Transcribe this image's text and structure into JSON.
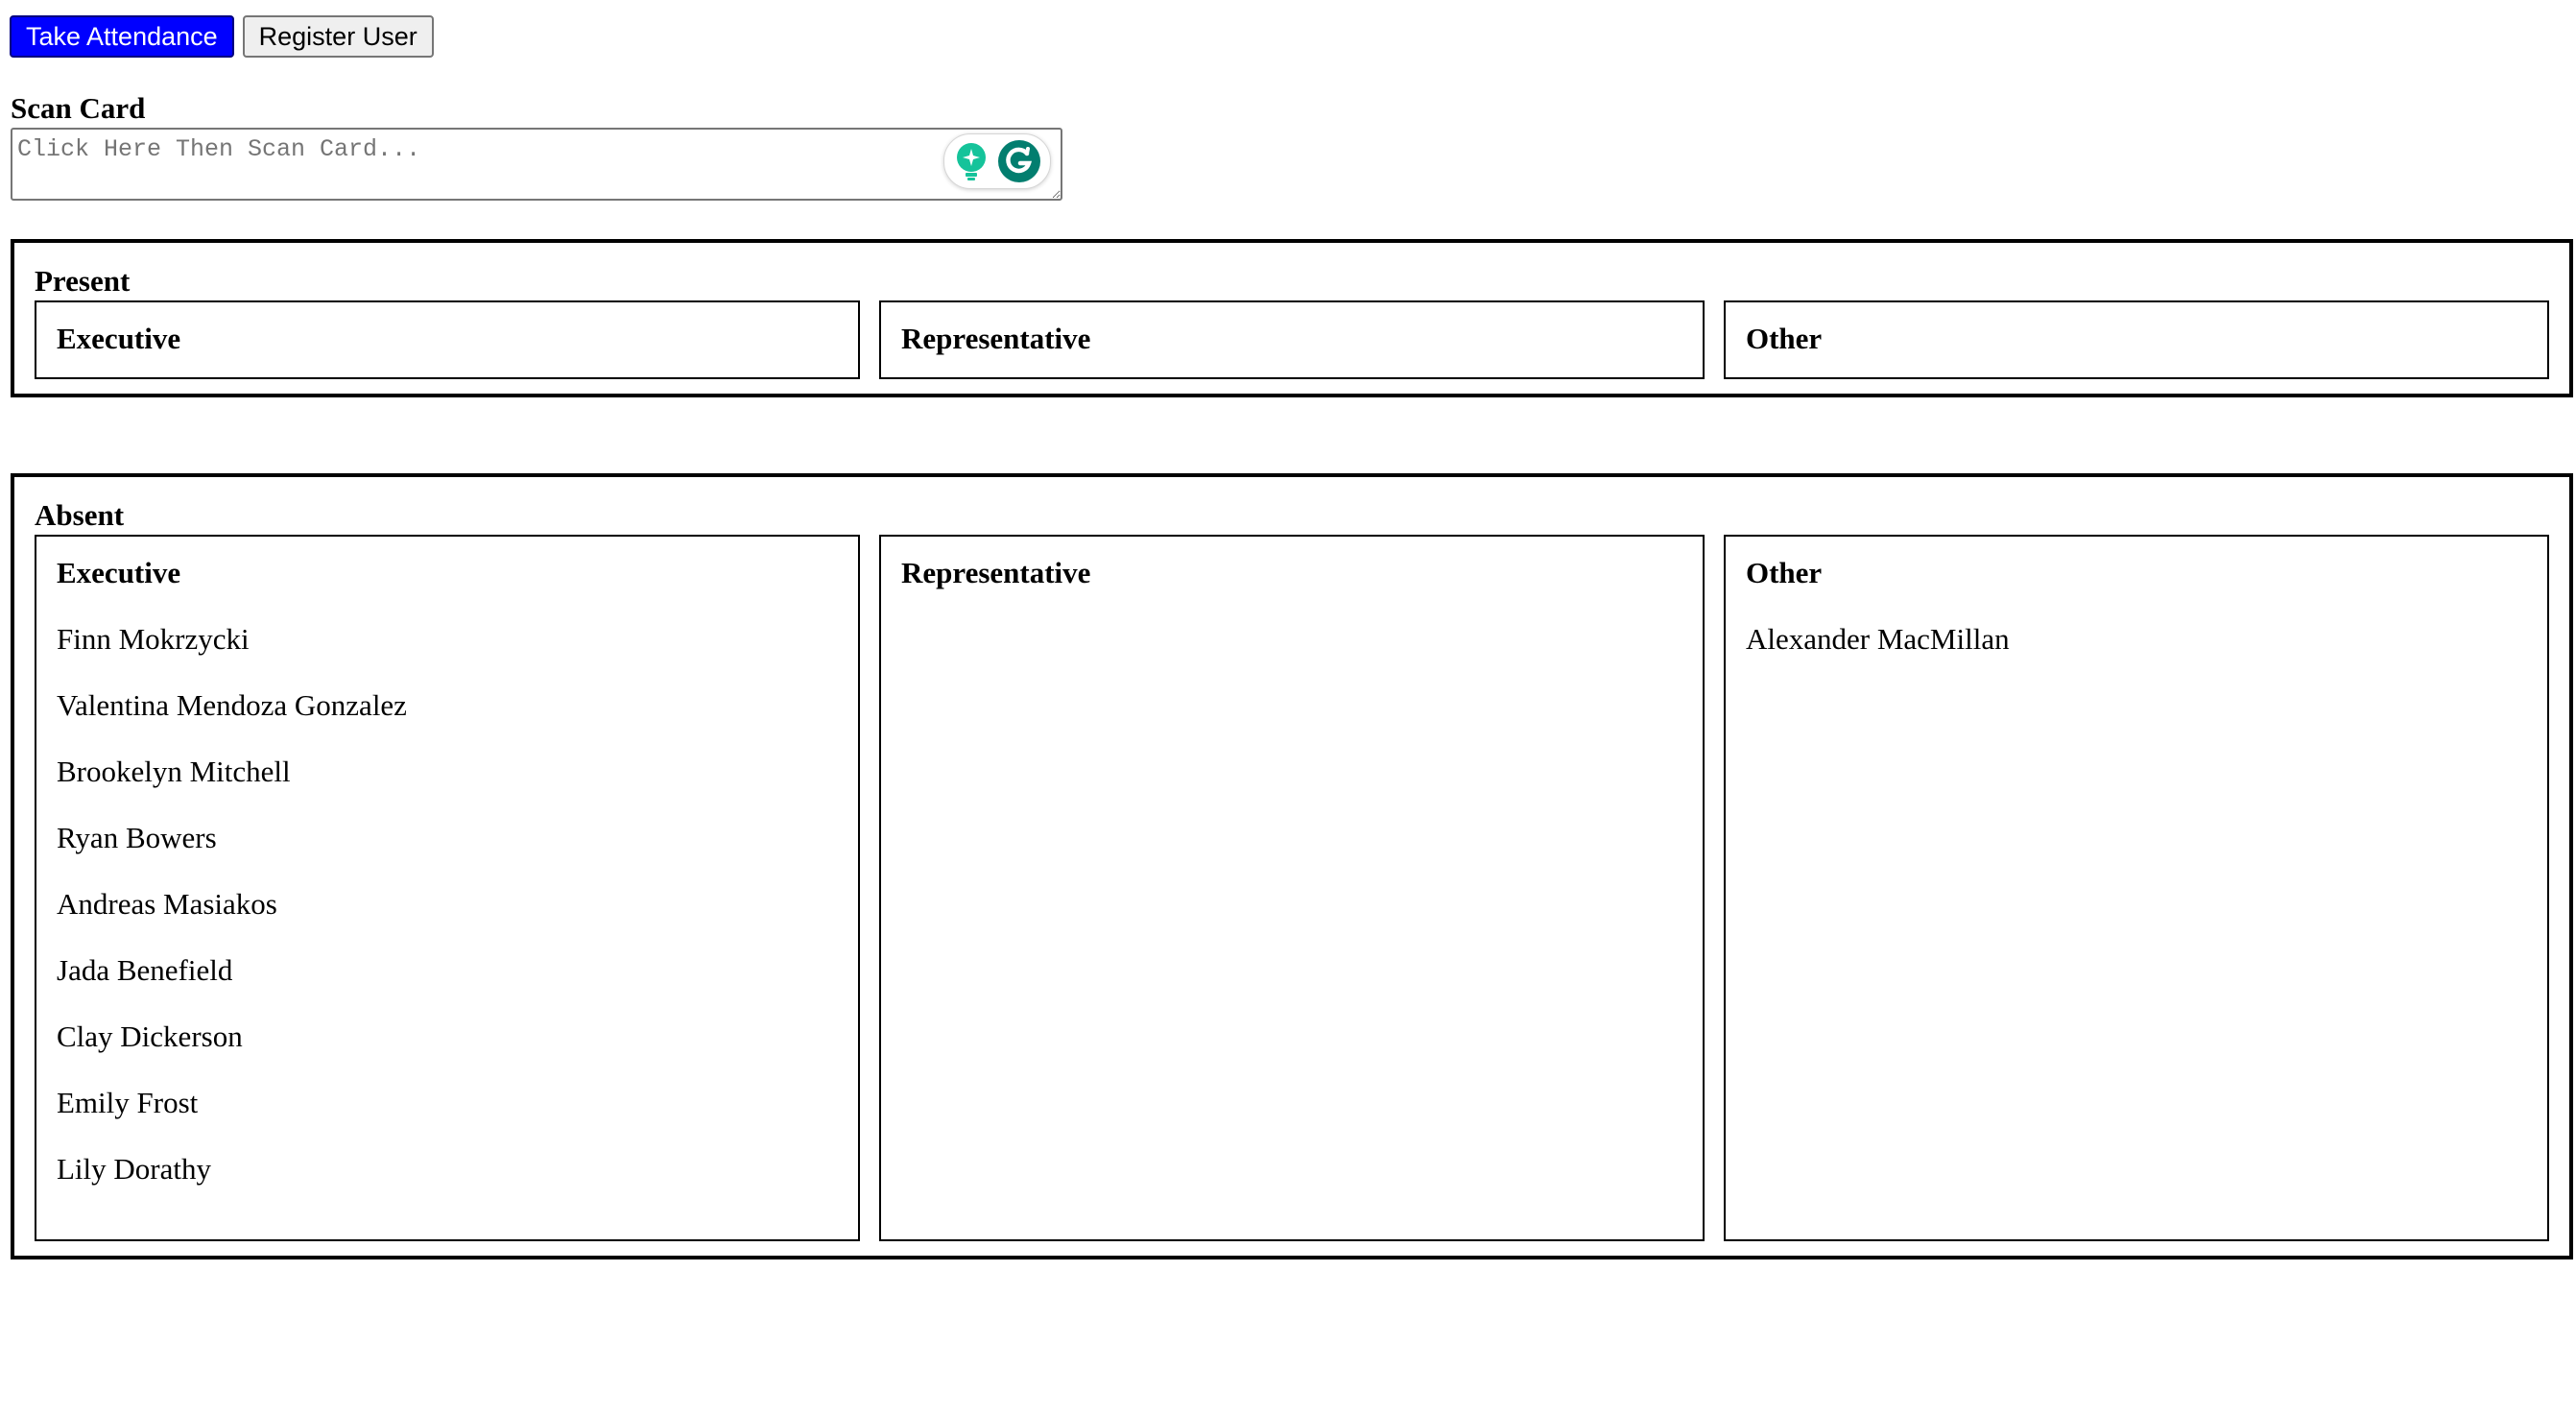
{
  "tabs": {
    "take_attendance": "Take Attendance",
    "register_user": "Register User"
  },
  "scan": {
    "label": "Scan Card",
    "placeholder": "Click Here Then Scan Card..."
  },
  "present": {
    "title": "Present",
    "columns": {
      "executive": {
        "title": "Executive",
        "names": []
      },
      "representative": {
        "title": "Representative",
        "names": []
      },
      "other": {
        "title": "Other",
        "names": []
      }
    }
  },
  "absent": {
    "title": "Absent",
    "columns": {
      "executive": {
        "title": "Executive",
        "names": [
          "Finn Mokrzycki",
          "Valentina Mendoza Gonzalez",
          "Brookelyn Mitchell",
          "Ryan Bowers",
          "Andreas Masiakos",
          "Jada Benefield",
          "Clay Dickerson",
          "Emily Frost",
          "Lily Dorathy"
        ]
      },
      "representative": {
        "title": "Representative",
        "names": []
      },
      "other": {
        "title": "Other",
        "names": [
          "Alexander MacMillan"
        ]
      }
    }
  },
  "colors": {
    "active_tab": "#0000ff",
    "grammarly_green": "#15c39a",
    "grammarly_dark": "#027e6f"
  },
  "icons": [
    "bulb-sparkle-icon",
    "grammarly-icon"
  ]
}
